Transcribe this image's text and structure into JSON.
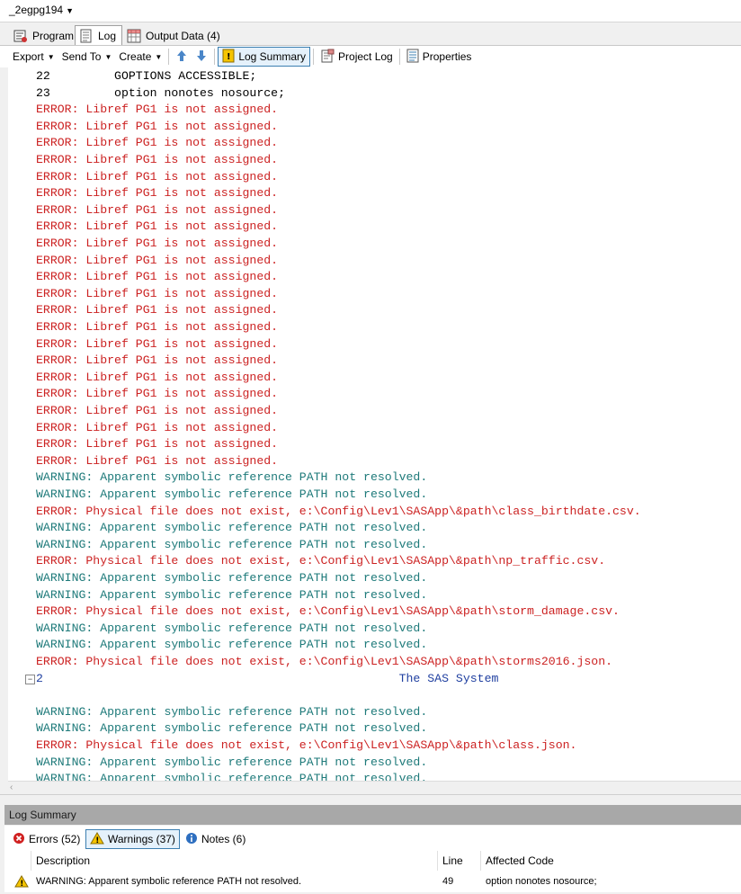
{
  "window": {
    "title": "_2egpg194"
  },
  "tabs": [
    {
      "label": "Program",
      "icon": "program-icon"
    },
    {
      "label": "Log",
      "icon": "log-icon"
    },
    {
      "label": "Output Data (4)",
      "icon": "output-data-icon"
    }
  ],
  "toolbar": {
    "export": "Export",
    "send_to": "Send To",
    "create": "Create",
    "log_summary": "Log Summary",
    "project_log": "Project Log",
    "properties": "Properties"
  },
  "log": {
    "lines": [
      {
        "type": "src",
        "text": "22         GOPTIONS ACCESSIBLE;"
      },
      {
        "type": "src",
        "text": "23         option nonotes nosource;"
      },
      {
        "type": "err",
        "text": "ERROR: Libref PG1 is not assigned."
      },
      {
        "type": "err",
        "text": "ERROR: Libref PG1 is not assigned."
      },
      {
        "type": "err",
        "text": "ERROR: Libref PG1 is not assigned."
      },
      {
        "type": "err",
        "text": "ERROR: Libref PG1 is not assigned."
      },
      {
        "type": "err",
        "text": "ERROR: Libref PG1 is not assigned."
      },
      {
        "type": "err",
        "text": "ERROR: Libref PG1 is not assigned."
      },
      {
        "type": "err",
        "text": "ERROR: Libref PG1 is not assigned."
      },
      {
        "type": "err",
        "text": "ERROR: Libref PG1 is not assigned."
      },
      {
        "type": "err",
        "text": "ERROR: Libref PG1 is not assigned."
      },
      {
        "type": "err",
        "text": "ERROR: Libref PG1 is not assigned."
      },
      {
        "type": "err",
        "text": "ERROR: Libref PG1 is not assigned."
      },
      {
        "type": "err",
        "text": "ERROR: Libref PG1 is not assigned."
      },
      {
        "type": "err",
        "text": "ERROR: Libref PG1 is not assigned."
      },
      {
        "type": "err",
        "text": "ERROR: Libref PG1 is not assigned."
      },
      {
        "type": "err",
        "text": "ERROR: Libref PG1 is not assigned."
      },
      {
        "type": "err",
        "text": "ERROR: Libref PG1 is not assigned."
      },
      {
        "type": "err",
        "text": "ERROR: Libref PG1 is not assigned."
      },
      {
        "type": "err",
        "text": "ERROR: Libref PG1 is not assigned."
      },
      {
        "type": "err",
        "text": "ERROR: Libref PG1 is not assigned."
      },
      {
        "type": "err",
        "text": "ERROR: Libref PG1 is not assigned."
      },
      {
        "type": "err",
        "text": "ERROR: Libref PG1 is not assigned."
      },
      {
        "type": "err",
        "text": "ERROR: Libref PG1 is not assigned."
      },
      {
        "type": "warn",
        "text": "WARNING: Apparent symbolic reference PATH not resolved."
      },
      {
        "type": "warn",
        "text": "WARNING: Apparent symbolic reference PATH not resolved."
      },
      {
        "type": "err",
        "text": "ERROR: Physical file does not exist, e:\\Config\\Lev1\\SASApp\\&path\\class_birthdate.csv."
      },
      {
        "type": "warn",
        "text": "WARNING: Apparent symbolic reference PATH not resolved."
      },
      {
        "type": "warn",
        "text": "WARNING: Apparent symbolic reference PATH not resolved."
      },
      {
        "type": "err",
        "text": "ERROR: Physical file does not exist, e:\\Config\\Lev1\\SASApp\\&path\\np_traffic.csv."
      },
      {
        "type": "warn",
        "text": "WARNING: Apparent symbolic reference PATH not resolved."
      },
      {
        "type": "warn",
        "text": "WARNING: Apparent symbolic reference PATH not resolved."
      },
      {
        "type": "err",
        "text": "ERROR: Physical file does not exist, e:\\Config\\Lev1\\SASApp\\&path\\storm_damage.csv."
      },
      {
        "type": "warn",
        "text": "WARNING: Apparent symbolic reference PATH not resolved."
      },
      {
        "type": "warn",
        "text": "WARNING: Apparent symbolic reference PATH not resolved."
      },
      {
        "type": "err",
        "text": "ERROR: Physical file does not exist, e:\\Config\\Lev1\\SASApp\\&path\\storms2016.json."
      },
      {
        "type": "head",
        "text": "2                                                  The SAS System"
      },
      {
        "type": "blank",
        "text": ""
      },
      {
        "type": "warn",
        "text": "WARNING: Apparent symbolic reference PATH not resolved."
      },
      {
        "type": "warn",
        "text": "WARNING: Apparent symbolic reference PATH not resolved."
      },
      {
        "type": "err",
        "text": "ERROR: Physical file does not exist, e:\\Config\\Lev1\\SASApp\\&path\\class.json."
      },
      {
        "type": "warn",
        "text": "WARNING: Apparent symbolic reference PATH not resolved."
      },
      {
        "type": "warn",
        "text": "WARNING: Apparent symbolic reference PATH not resolved."
      }
    ]
  },
  "log_summary": {
    "title": "Log Summary",
    "errors_label": "Errors (52)",
    "warnings_label": "Warnings (37)",
    "notes_label": "Notes (6)",
    "columns": {
      "description": "Description",
      "line": "Line",
      "affected": "Affected Code"
    },
    "rows": [
      {
        "description": "WARNING: Apparent symbolic reference PATH not resolved.",
        "line": "49",
        "affected": "option nonotes nosource;"
      }
    ]
  },
  "colors": {
    "error": "#cc2222",
    "warning": "#1e7a7a",
    "header": "#1f3fa0",
    "accent": "#3c7fb1"
  }
}
